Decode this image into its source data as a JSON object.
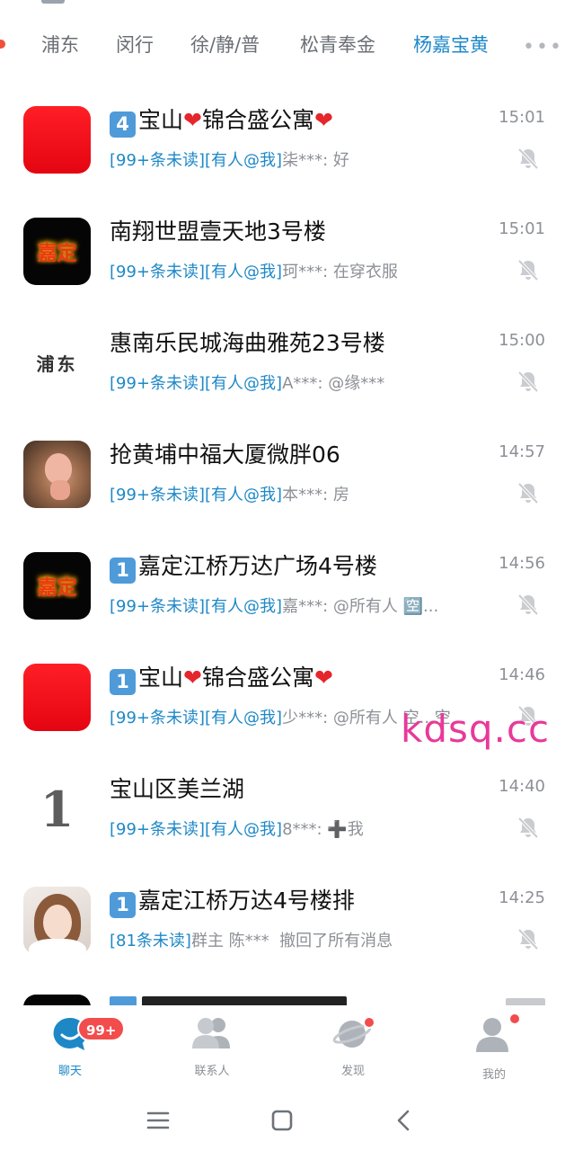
{
  "tabs": {
    "items": [
      "浦东",
      "闵行",
      "徐/静/普",
      "松青奉金",
      "杨嘉宝黄"
    ],
    "active_index": 4,
    "more_label": "•••"
  },
  "chats": [
    {
      "avatar": "red-square",
      "title_prefix_keycap": "4",
      "title_parts": [
        "宝山",
        "❤",
        "锦合盛公寓",
        "❤"
      ],
      "time": "15:01",
      "unread": "[99+条未读]",
      "mention": "[有人@我]",
      "sender": "柒***",
      "message": "好",
      "muted": true
    },
    {
      "avatar": "fire-jiading",
      "avatar_text": "嘉定",
      "title_text": "南翔世盟壹天地3号楼",
      "time": "15:01",
      "unread": "[99+条未读]",
      "mention": "[有人@我]",
      "sender": "珂***",
      "message": "在穿衣服",
      "muted": true
    },
    {
      "avatar": "text-pudong",
      "avatar_text": "浦东",
      "title_text": "惠南乐民城海曲雅苑23号楼",
      "time": "15:00",
      "unread": "[99+条未读]",
      "mention": "[有人@我]",
      "sender": "A***",
      "message": " @缘***",
      "muted": true
    },
    {
      "avatar": "pig-photo",
      "title_text": "抢黄埔中福大厦微胖06",
      "time": "14:57",
      "unread": "[99+条未读]",
      "mention": "[有人@我]",
      "sender": "本***",
      "message": "房",
      "muted": true
    },
    {
      "avatar": "fire-jiading",
      "avatar_text": "嘉定",
      "title_prefix_keycap": "1",
      "title_text": "嘉定江桥万达广场4号楼",
      "time": "14:56",
      "unread": "[99+条未读]",
      "mention": "[有人@我]",
      "sender": "嘉***",
      "message": " @所有人 🈳...",
      "muted": true
    },
    {
      "avatar": "red-square",
      "title_prefix_keycap": "1",
      "title_parts": [
        "宝山",
        "❤",
        "锦合盛公寓",
        "❤"
      ],
      "time": "14:46",
      "unread": "[99+条未读]",
      "mention": "[有人@我]",
      "sender": "少***",
      "message": "@所有人 空...空",
      "muted": true
    },
    {
      "avatar": "number-one",
      "avatar_text": "1",
      "title_text": "宝山区美兰湖",
      "time": "14:40",
      "unread": "[99+条未读]",
      "mention": "[有人@我]",
      "sender": "8***",
      "message": "➕我",
      "muted": true
    },
    {
      "avatar": "girl-photo",
      "title_prefix_keycap": "1",
      "title_text": "嘉定江桥万达4号楼排",
      "time": "14:25",
      "unread": "[81条未读]",
      "mention": "",
      "sender": "群主 陈***",
      "message": "撤回了所有消息",
      "muted": true
    }
  ],
  "watermark": "kdsq.cc",
  "bottom_nav": {
    "items": [
      {
        "label": "聊天",
        "icon": "chat-bubble-icon",
        "active": true
      },
      {
        "label": "联系人",
        "icon": "contacts-icon",
        "active": false
      },
      {
        "label": "发现",
        "icon": "planet-icon",
        "active": false
      },
      {
        "label": "我的",
        "icon": "profile-icon",
        "active": false
      }
    ],
    "chat_badge": "99+"
  },
  "colors": {
    "accent": "#1e88c7",
    "badge": "#f24c4c",
    "muted_text": "#8d9096",
    "watermark": "#e8399a"
  }
}
